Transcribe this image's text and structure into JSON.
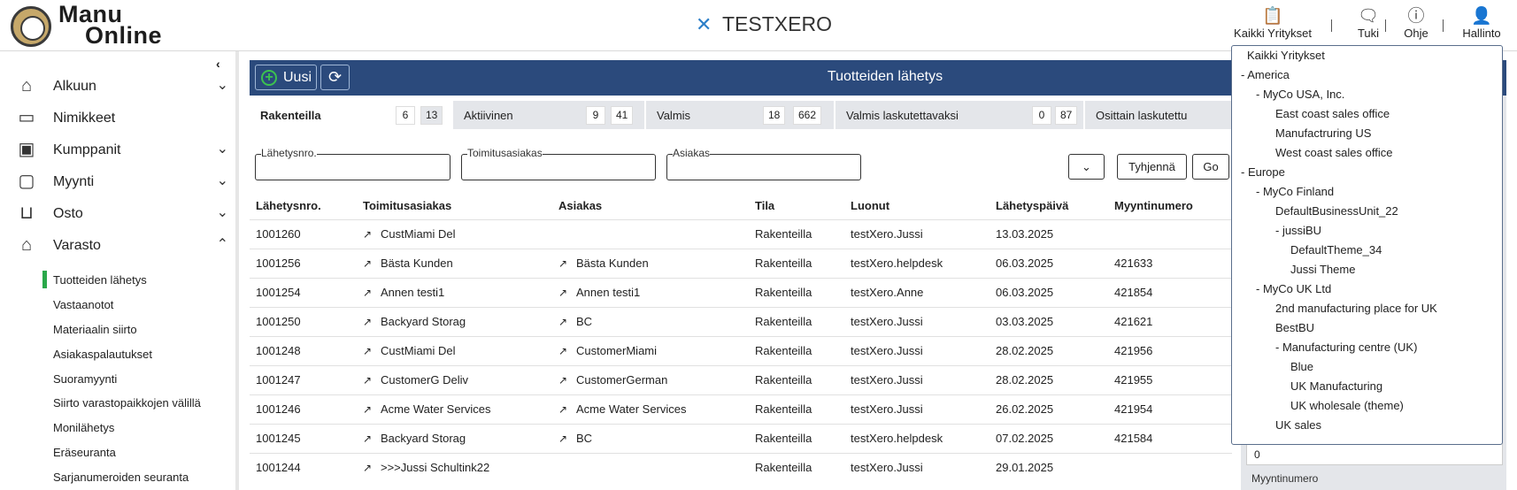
{
  "brand": {
    "line1": "Manu",
    "line2": "Online"
  },
  "company": {
    "icon": "x-logo-icon",
    "name": "TESTXERO"
  },
  "topnav": [
    {
      "label": "Kaikki Yritykset",
      "icon": "clipboard-icon"
    },
    {
      "label": "Tuki",
      "icon": "chat-icon"
    },
    {
      "label": "Ohje",
      "icon": "help-icon"
    },
    {
      "label": "Hallinto",
      "icon": "user-icon"
    }
  ],
  "sidebar": {
    "items": [
      {
        "label": "Alkuun",
        "icon": "home-icon",
        "chevron": "down"
      },
      {
        "label": "Nimikkeet",
        "icon": "inbox-icon",
        "chevron": ""
      },
      {
        "label": "Kumppanit",
        "icon": "contact-icon",
        "chevron": "down"
      },
      {
        "label": "Myynti",
        "icon": "wallet-icon",
        "chevron": "down"
      },
      {
        "label": "Osto",
        "icon": "basket-icon",
        "chevron": "down"
      },
      {
        "label": "Varasto",
        "icon": "warehouse-icon",
        "chevron": "up"
      }
    ],
    "sub_items": [
      "Tuotteiden lähetys",
      "Vastaanotot",
      "Materiaalin siirto",
      "Asiakaspalautukset",
      "Suoramyynti",
      "Siirto varastopaikkojen välillä",
      "Monilähetys",
      "Eräseuranta",
      "Sarjanumeroiden seuranta"
    ]
  },
  "header": {
    "new_label": "Uusi",
    "title": "Tuotteiden lähetys"
  },
  "tabs": [
    {
      "label": "Rakenteilla",
      "a": "6",
      "b": "13"
    },
    {
      "label": "Aktiivinen",
      "a": "9",
      "b": "41"
    },
    {
      "label": "Valmis",
      "a": "18",
      "b": "662"
    },
    {
      "label": "Valmis laskutettavaksi",
      "a": "0",
      "b": "87"
    },
    {
      "label": "Osittain laskutettu",
      "a": "",
      "b": ""
    }
  ],
  "filters": {
    "labels": [
      "Lähetysnro.",
      "Toimitusasiakas",
      "Asiakas"
    ],
    "clear_label": "Tyhjennä",
    "go_label": "Go"
  },
  "table": {
    "columns": [
      "Lähetysnro.",
      "Toimitusasiakas",
      "Asiakas",
      "Tila",
      "Luonut",
      "Lähetyspäivä",
      "Myyntinumero"
    ],
    "rows": [
      [
        "1001260",
        "CustMiami Del",
        "",
        "Rakenteilla",
        "testXero.Jussi",
        "13.03.2025",
        ""
      ],
      [
        "1001256",
        "Bästa Kunden",
        "Bästa Kunden",
        "Rakenteilla",
        "testXero.helpdesk",
        "06.03.2025",
        "421633"
      ],
      [
        "1001254",
        "Annen testi1",
        "Annen testi1",
        "Rakenteilla",
        "testXero.Anne",
        "06.03.2025",
        "421854"
      ],
      [
        "1001250",
        "Backyard Storag",
        "BC",
        "Rakenteilla",
        "testXero.Jussi",
        "03.03.2025",
        "421621"
      ],
      [
        "1001248",
        "CustMiami Del",
        "CustomerMiami",
        "Rakenteilla",
        "testXero.Jussi",
        "28.02.2025",
        "421956"
      ],
      [
        "1001247",
        "CustomerG Deliv",
        "CustomerGerman",
        "Rakenteilla",
        "testXero.Jussi",
        "28.02.2025",
        "421955"
      ],
      [
        "1001246",
        "Acme Water Services",
        "Acme Water Services",
        "Rakenteilla",
        "testXero.Jussi",
        "26.02.2025",
        "421954"
      ],
      [
        "1001245",
        "Backyard Storag",
        "BC",
        "Rakenteilla",
        "testXero.helpdesk",
        "07.02.2025",
        "421584"
      ],
      [
        "1001244",
        ">>>Jussi Schultink22",
        "",
        "Rakenteilla",
        "testXero.Jussi",
        "29.01.2025",
        ""
      ]
    ]
  },
  "right_panel": {
    "value": "0",
    "label": "Myyntinumero"
  },
  "company_menu": [
    {
      "text": "Kaikki Yritykset",
      "level": 0
    },
    {
      "text": "- America",
      "level": 1
    },
    {
      "text": "- MyCo USA, Inc.",
      "level": 2
    },
    {
      "text": "East coast sales office",
      "level": 3
    },
    {
      "text": "Manufactruring US",
      "level": 3
    },
    {
      "text": "West coast sales office",
      "level": 3
    },
    {
      "text": "- Europe",
      "level": 1
    },
    {
      "text": "- MyCo Finland",
      "level": 2
    },
    {
      "text": "DefaultBusinessUnit_22",
      "level": 3
    },
    {
      "text": "- jussiBU",
      "level": 4
    },
    {
      "text": "DefaultTheme_34",
      "level": 5
    },
    {
      "text": "Jussi Theme",
      "level": 5
    },
    {
      "text": "- MyCo UK Ltd",
      "level": 2
    },
    {
      "text": "2nd manufacturing place for UK",
      "level": 3
    },
    {
      "text": "BestBU",
      "level": 3
    },
    {
      "text": "- Manufacturing centre (UK)",
      "level": 4
    },
    {
      "text": "Blue",
      "level": 5
    },
    {
      "text": "UK Manufacturing",
      "level": 5
    },
    {
      "text": "UK wholesale (theme)",
      "level": 5
    },
    {
      "text": "UK sales",
      "level": 3
    }
  ]
}
